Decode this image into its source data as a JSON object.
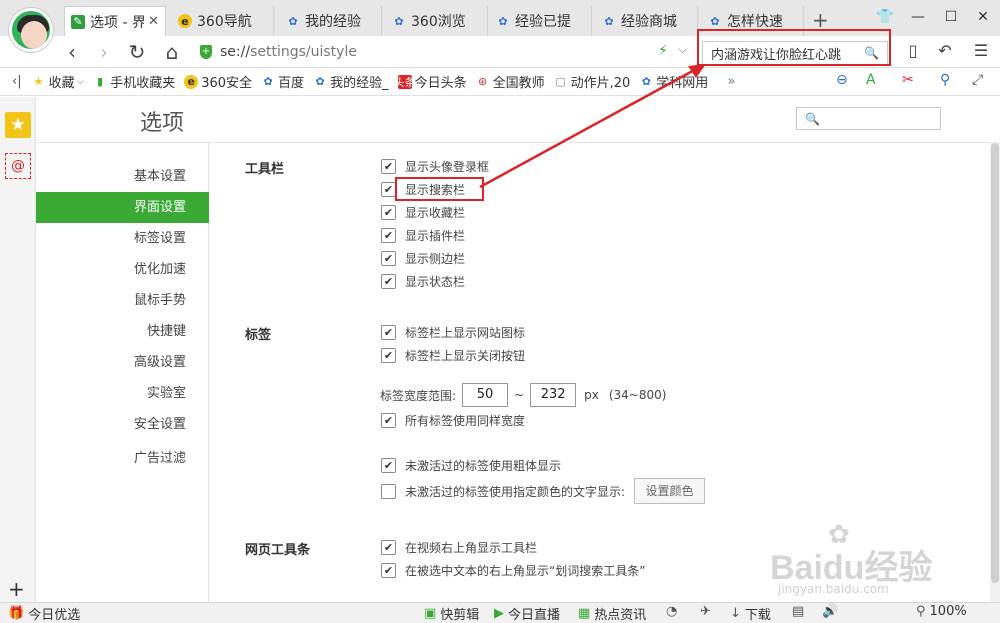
{
  "tabs": [
    {
      "icon": "wrench-icon",
      "label": "选项 - 界",
      "active": true,
      "closable": true
    },
    {
      "icon": "360-logo-icon",
      "label": "360导航"
    },
    {
      "icon": "baidu-paw-icon",
      "label": "我的经验"
    },
    {
      "icon": "baidu-paw-icon",
      "label": "360浏览"
    },
    {
      "icon": "baidu-paw-icon",
      "label": "经验已提"
    },
    {
      "icon": "baidu-paw-icon",
      "label": "经验商城"
    },
    {
      "icon": "baidu-paw-icon",
      "label": "怎样快速"
    }
  ],
  "address": {
    "host": "se://",
    "path": "settings/uistyle"
  },
  "search_bar": {
    "value": "内涵游戏让你脸红心跳"
  },
  "bookmarks": [
    {
      "icon": "star-icon",
      "label": "收藏",
      "dropdown": "⌵"
    },
    {
      "icon": "phone-icon",
      "label": "手机收藏夹"
    },
    {
      "icon": "360-logo-icon",
      "label": "360安全"
    },
    {
      "icon": "baidu-paw-icon",
      "label": "百度"
    },
    {
      "icon": "baidu-paw-icon",
      "label": "我的经验_"
    },
    {
      "icon": "news-icon",
      "label": "今日头条",
      "badge": "头条"
    },
    {
      "icon": "edu-icon",
      "label": "全国教师"
    },
    {
      "icon": "file-icon",
      "label": "动作片,20"
    },
    {
      "icon": "baidu-paw-icon",
      "label": "学科网用"
    }
  ],
  "page": {
    "title": "选项"
  },
  "left_nav": [
    {
      "label": "基本设置"
    },
    {
      "label": "界面设置",
      "active": true
    },
    {
      "label": "标签设置"
    },
    {
      "label": "优化加速"
    },
    {
      "label": "鼠标手势"
    },
    {
      "label": "快捷键"
    },
    {
      "label": "高级设置"
    },
    {
      "label": "实验室"
    },
    {
      "label": "安全设置"
    },
    {
      "label": "广告过滤"
    }
  ],
  "toolbar_section": {
    "label": "工具栏",
    "options": [
      {
        "label": "显示头像登录框",
        "checked": true
      },
      {
        "label": "显示搜索栏",
        "checked": true
      },
      {
        "label": "显示收藏栏",
        "checked": true
      },
      {
        "label": "显示插件栏",
        "checked": true
      },
      {
        "label": "显示侧边栏",
        "checked": true
      },
      {
        "label": "显示状态栏",
        "checked": true
      }
    ]
  },
  "tabs_section": {
    "label": "标签",
    "options": [
      {
        "label": "标签栏上显示网站图标",
        "checked": true
      },
      {
        "label": "标签栏上显示关闭按钮",
        "checked": true
      }
    ],
    "width_label": "标签宽度范围:",
    "width_min": "50",
    "width_sep": "~",
    "width_max": "232",
    "width_unit": "px",
    "width_hint": "(34~800)",
    "same_width": {
      "label": "所有标签使用同样宽度",
      "checked": true
    },
    "bold_inactive": {
      "label": "未激活过的标签使用粗体显示",
      "checked": true
    },
    "color_inactive": {
      "label": "未激活过的标签使用指定颜色的文字显示:",
      "checked": false
    },
    "set_color_button": "设置颜色"
  },
  "webtoolbar_section": {
    "label": "网页工具条",
    "options": [
      {
        "label": "在视频右上角显示工具栏",
        "checked": true
      },
      {
        "label": "在被选中文本的右上角显示“划词搜索工具条”",
        "checked": true
      }
    ]
  },
  "status_bar": {
    "left": "今日优选",
    "items": [
      "快剪辑",
      "今日直播",
      "热点资讯",
      "下载"
    ],
    "zoom": "100%"
  },
  "watermark": {
    "brand": "Baidu经验",
    "url": "jingyan.baidu.com"
  },
  "colors": {
    "accent_green": "#3aaa35",
    "annotation_red": "#d9252a",
    "tab_strip": "#e7e7e7"
  }
}
